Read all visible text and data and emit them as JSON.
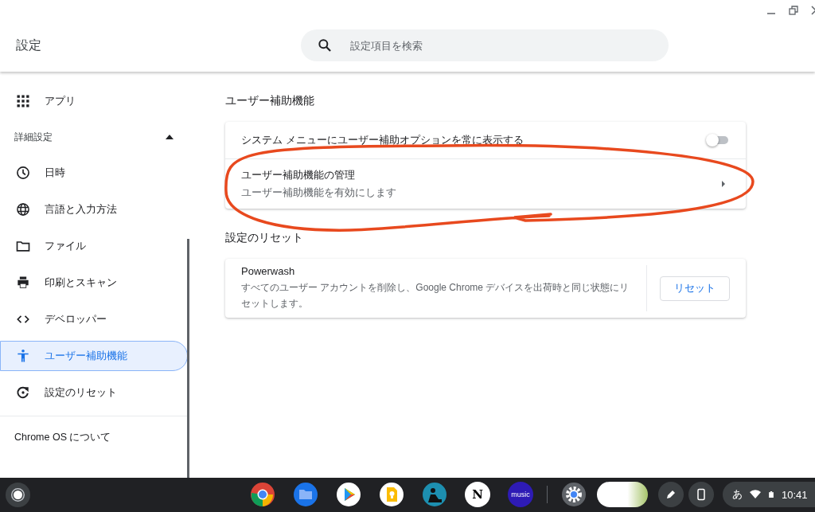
{
  "window": {
    "title": "設定"
  },
  "search": {
    "placeholder": "設定項目を検索"
  },
  "sidebar": {
    "items": [
      {
        "kind": "item",
        "label": "アプリ",
        "selected": false
      },
      {
        "kind": "heading",
        "label": "詳細設定",
        "expanded": true
      },
      {
        "kind": "item",
        "label": "日時",
        "selected": false
      },
      {
        "kind": "item",
        "label": "言語と入力方法",
        "selected": false
      },
      {
        "kind": "item",
        "label": "ファイル",
        "selected": false
      },
      {
        "kind": "item",
        "label": "印刷とスキャン",
        "selected": false
      },
      {
        "kind": "item",
        "label": "デベロッパー",
        "selected": false
      },
      {
        "kind": "item",
        "label": "ユーザー補助機能",
        "selected": true
      },
      {
        "kind": "item",
        "label": "設定のリセット",
        "selected": false
      }
    ],
    "footer_link": "Chrome OS について"
  },
  "sections": [
    {
      "title": "ユーザー補助機能",
      "rows": [
        {
          "kind": "toggle",
          "label": "システム メニューにユーザー補助オプションを常に表示する",
          "on": false
        },
        {
          "kind": "link",
          "label": "ユーザー補助機能の管理",
          "sublabel": "ユーザー補助機能を有効にします"
        }
      ]
    },
    {
      "title": "設定のリセット",
      "rows": [
        {
          "kind": "action",
          "label": "Powerwash",
          "sublabel": "すべてのユーザー アカウントを削除し、Google Chrome デバイスを出荷時と同じ状態にリセットします。",
          "button": "リセット"
        }
      ]
    }
  ],
  "shelf": {
    "app_labels": [
      "N",
      "music"
    ],
    "status": {
      "ime": "あ",
      "time": "10:41"
    }
  }
}
